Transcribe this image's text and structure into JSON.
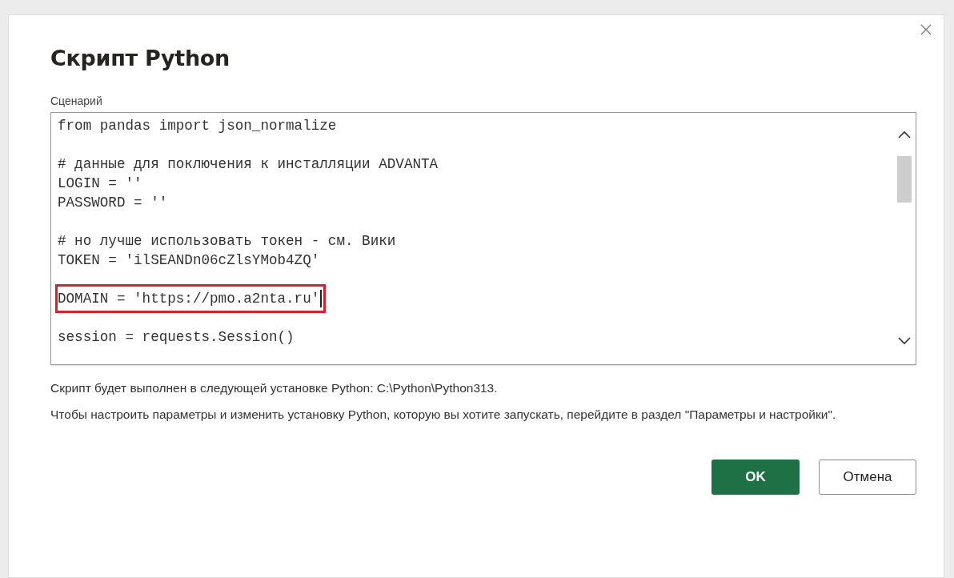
{
  "dialog": {
    "title": "Скрипт Python",
    "script_label": "Сценарий",
    "code_lines": [
      {
        "kind": "code",
        "text": "from pandas import json_normalize",
        "highlighted": false
      },
      {
        "kind": "blank"
      },
      {
        "kind": "code",
        "text": "# данные для поключения к инсталляции ADVANTA",
        "highlighted": false
      },
      {
        "kind": "code",
        "text": "LOGIN = ''",
        "highlighted": false
      },
      {
        "kind": "code",
        "text": "PASSWORD = ''",
        "highlighted": false
      },
      {
        "kind": "blank"
      },
      {
        "kind": "code",
        "text": "# но лучше использовать токен - см. Вики",
        "highlighted": false
      },
      {
        "kind": "code",
        "text": "TOKEN = 'ilSEANDn06cZlsYMob4ZQ'",
        "highlighted": false
      },
      {
        "kind": "blank"
      },
      {
        "kind": "code",
        "text": "DOMAIN = 'https://pmo.a2nta.ru'",
        "highlighted": true
      },
      {
        "kind": "blank"
      },
      {
        "kind": "code",
        "text": "session = requests.Session()",
        "highlighted": false
      }
    ],
    "info_lines": [
      "Скрипт будет выполнен в следующей установке Python: C:\\Python\\Python313.",
      "Чтобы настроить параметры и изменить установку Python, которую вы хотите запускать, перейдите в раздел \"Параметры и настройки\"."
    ],
    "buttons": [
      {
        "label": "OK",
        "kind": "primary"
      },
      {
        "label": "Отмена",
        "kind": "secondary"
      }
    ]
  }
}
